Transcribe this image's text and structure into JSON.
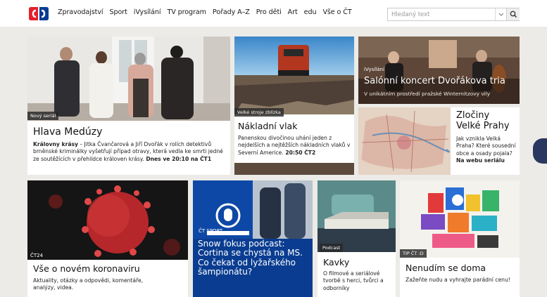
{
  "nav": {
    "items": [
      "Zpravodajství",
      "Sport",
      "iVysílání",
      "TV program",
      "Pořady A–Z",
      "Pro děti",
      "Art",
      "edu",
      "Vše o ČT"
    ]
  },
  "search": {
    "placeholder": "Hledaný text"
  },
  "tiles": {
    "meduzy": {
      "tag": "Nový seriál",
      "title": "Hlava Medúzy",
      "desc_bold": "Královny krásy",
      "desc_text": " – Jitka Čvančarová a Jiří Dvořák v rolích detektivů brněnské kriminálky vyšetřují případ otravy, která vedla ke smrti jedné ze soutěžících v přehlídce královen krásy.",
      "desc_time": " Dnes ve 20:10 na ČT1"
    },
    "vlak": {
      "tag": "Velké stroje zblízka",
      "title": "Nákladní vlak",
      "desc_text": "Panenskou divočinou uhání jeden z nejdelších a nejtěžších nákladních vlaků v Severní Americe.",
      "desc_time": " 20:50 ČT2"
    },
    "koncert": {
      "tag": "iVysílání",
      "title": "Salónní koncert Dvořákova tria",
      "desc_text": "V unikátním prostředí pražské Winternitzovy vily"
    },
    "zlociny": {
      "title_line1": "Zločiny",
      "title_line2": "Velké Prahy",
      "desc_text": "Jak vznikla Velká Praha? Které sousední obce a osady pojala?",
      "desc_link": " Na webu seriálu"
    },
    "koronavirus": {
      "tag": "ČT24",
      "title": "Vše o novém koronaviru",
      "desc_text": "Aktuality, otázky a odpovědi, komentáře, analýzy, videa."
    },
    "podcast": {
      "tag": "ČT SPORT",
      "title": "Snow fokus podcast: Cortina se chystá na MS. Co čekat od lyžařského šampionátu?"
    },
    "kavky": {
      "tag": "Podcast",
      "title": "Kavky",
      "desc_text": "O filmové a seriálové tvorbě s herci, tvůrci a odborníky"
    },
    "nenudim": {
      "tag": "TIP ČT :D",
      "title": "Nenudím se doma",
      "desc_text": "Zažeňte nudu a vyhrajte parádní cenu!"
    }
  },
  "colors": {
    "brand_red": "#e6202b",
    "brand_blue": "#0a3d91",
    "page_bg": "#ecebe7"
  },
  "icons": [
    "ct-logo-icon",
    "chevron-down-icon",
    "search-icon"
  ]
}
